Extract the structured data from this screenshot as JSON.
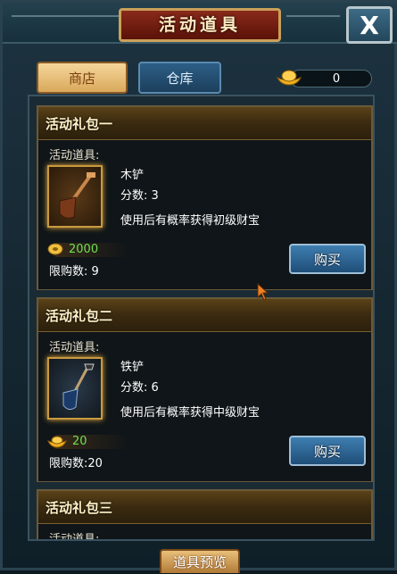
{
  "window": {
    "title": "活动道具",
    "close_label": "X"
  },
  "tabs": [
    {
      "label": "商店",
      "active": true
    },
    {
      "label": "仓库",
      "active": false
    }
  ],
  "currency": {
    "amount": "0",
    "icon": "gold-ingot-icon"
  },
  "packs": [
    {
      "title": "活动礼包一",
      "items_label": "活动道具:",
      "item_name": "木铲",
      "score": "分数:  3",
      "description": "使用后有概率获得初级财宝",
      "price": "2000",
      "price_icon": "coin-icon",
      "limit": "限购数:  9",
      "buy_label": "购买"
    },
    {
      "title": "活动礼包二",
      "items_label": "活动道具:",
      "item_name": "铁铲",
      "score": "分数:  6",
      "description": "使用后有概率获得中级财宝",
      "price": "20",
      "price_icon": "gold-ingot-icon",
      "limit": "限购数:20",
      "buy_label": "购买"
    },
    {
      "title": "活动礼包三",
      "items_label": "活动道具:"
    }
  ],
  "footer": {
    "preview_label": "道具预览"
  },
  "colors": {
    "price_green": "#6ee050",
    "accent_gold": "#c9a05a",
    "button_blue": "#2f6a98"
  }
}
